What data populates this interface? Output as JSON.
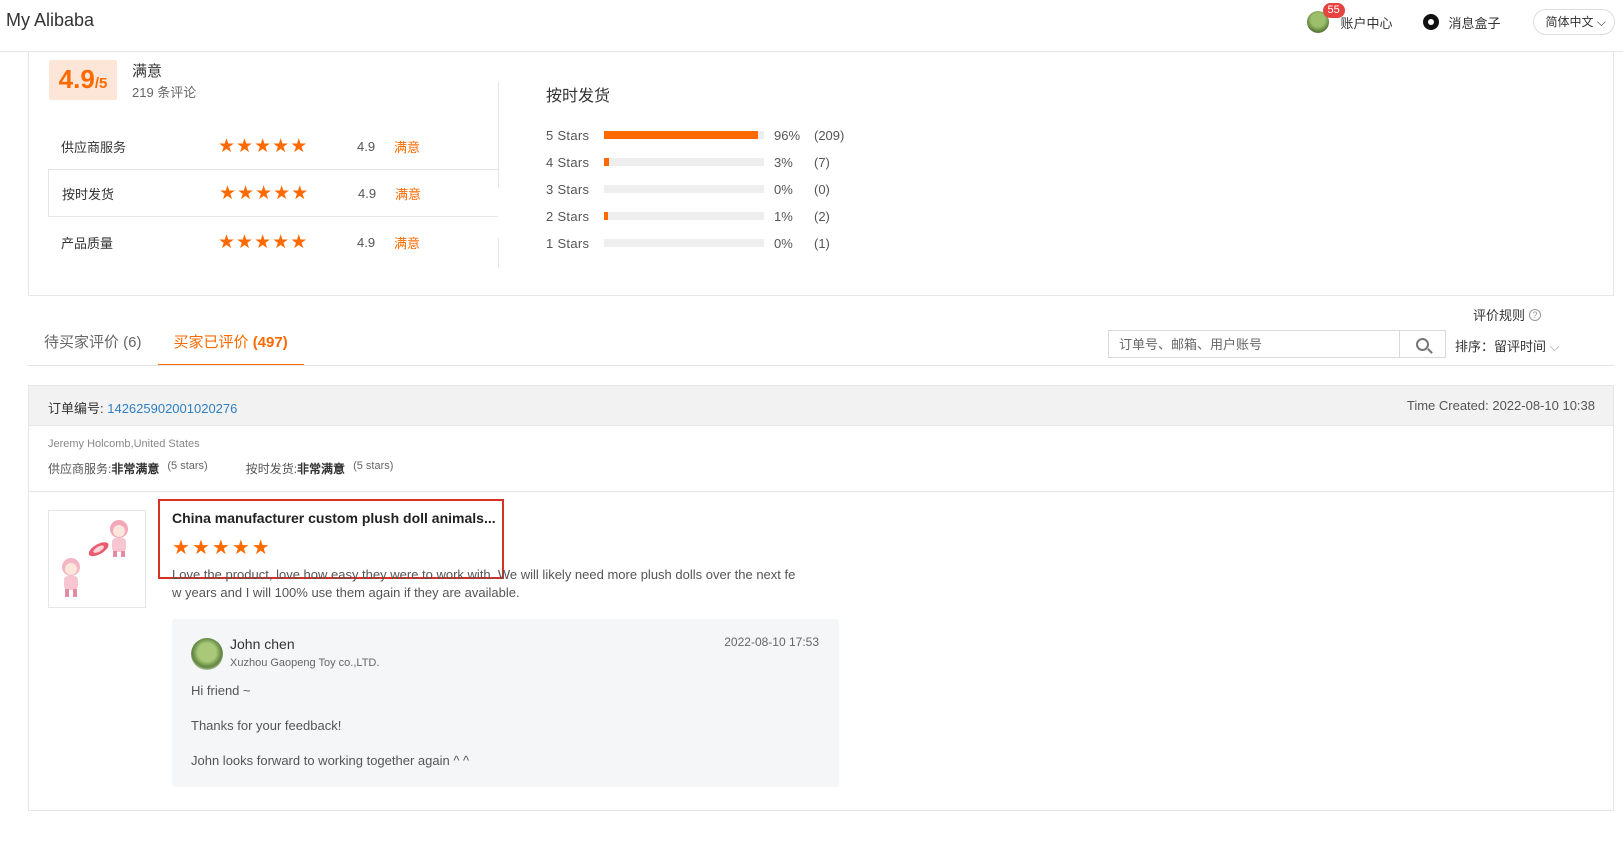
{
  "header": {
    "brand": "My Alibaba",
    "badge_count": "55",
    "account_label": "账户中心",
    "messages_label": "消息盒子",
    "language": "简体中文"
  },
  "summary": {
    "score": "4.9",
    "score_denominator": "/5",
    "score_title": "满意",
    "review_count": "219 条评论",
    "metrics": [
      {
        "label": "供应商服务",
        "stars": 5,
        "score": "4.9",
        "tag": "满意"
      },
      {
        "label": "按时发货",
        "stars": 5,
        "score": "4.9",
        "tag": "满意"
      },
      {
        "label": "产品质量",
        "stars": 5,
        "score": "4.9",
        "tag": "满意"
      }
    ],
    "distribution_title": "按时发货",
    "distribution": [
      {
        "label": "5  Stars",
        "percent": "96%",
        "count": "(209)",
        "fill": 0.96
      },
      {
        "label": "4  Stars",
        "percent": "3%",
        "count": "(7)",
        "fill": 0.03
      },
      {
        "label": "3  Stars",
        "percent": "0%",
        "count": "(0)",
        "fill": 0.0
      },
      {
        "label": "2  Stars",
        "percent": "1%",
        "count": "(2)",
        "fill": 0.01
      },
      {
        "label": "1  Stars",
        "percent": "0%",
        "count": "(1)",
        "fill": 0.0
      }
    ]
  },
  "toolbar": {
    "rules_label": "评价规则",
    "tab_pending_label": "待买家评价 ",
    "tab_pending_count": "(6)",
    "tab_reviewed_label": "买家已评价 ",
    "tab_reviewed_count": "(497)",
    "search_placeholder": "订单号、邮箱、用户账号",
    "sort_label": "排序：留评时间"
  },
  "order": {
    "order_no_label": "订单编号: ",
    "order_no_value": "142625902001020276",
    "time_created": "Time Created: 2022-08-10 10:38",
    "buyer": "Jeremy Holcomb,United States",
    "supplier_service_label": "供应商服务: ",
    "supplier_service_value": "非常满意",
    "supplier_service_stars": "(5 stars)",
    "shipping_label": "按时发货: ",
    "shipping_value": "非常满意",
    "shipping_stars": "(5 stars)",
    "product_title": "China manufacturer custom plush doll animals...",
    "product_stars": 5,
    "review_text": "Love the product, love how easy they were to work with. We will likely need more plush dolls over the next few years and I will 100% use them again if they are available.",
    "reply": {
      "name": "John chen",
      "company": "Xuzhou Gaopeng Toy co.,LTD.",
      "time": "2022-08-10 17:53",
      "line1": "Hi friend ~",
      "line2": "Thanks for your feedback!",
      "line3": "John looks forward to working together again ^ ^"
    }
  },
  "colors": {
    "accent": "#ff6a00",
    "link": "#2f7ec0",
    "highlight_border": "#d93025"
  }
}
